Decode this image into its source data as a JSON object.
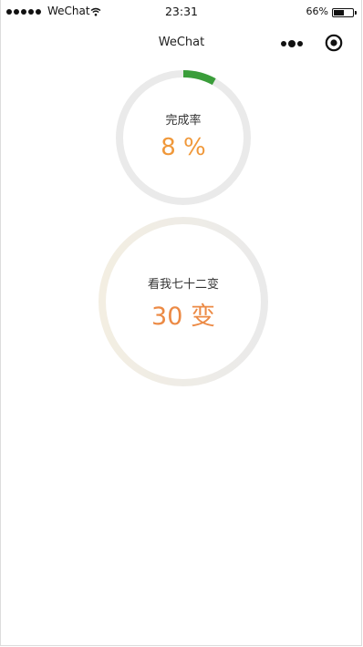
{
  "status_bar": {
    "carrier": "WeChat",
    "time": "23:31",
    "battery_percent": "66%"
  },
  "nav": {
    "title": "WeChat",
    "more_icon": "more-dots-icon",
    "target_icon": "record-target-icon"
  },
  "progress_ring": {
    "label": "完成率",
    "value_text": "8 %",
    "progress": 0.08,
    "track_color": "#eaeaea",
    "progress_color": "#3a9d3a",
    "value_color": "#f0983a"
  },
  "change_ring": {
    "label": "看我七十二变",
    "value_text": "30 变",
    "track_color": "#eaeaea",
    "tint_color": "#f3eee2",
    "value_color": "#ec8a45"
  }
}
